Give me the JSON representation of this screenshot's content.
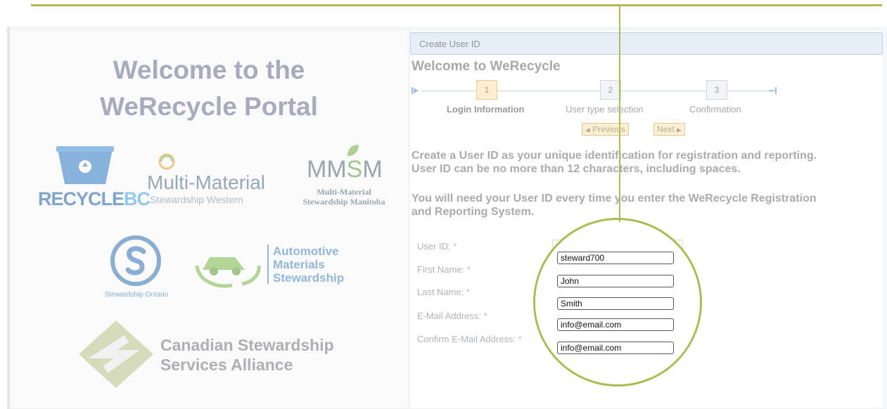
{
  "left_panel": {
    "welcome_line1": "Welcome to the",
    "welcome_line2": "WeRecycle Portal",
    "logos": {
      "recyclebc_a": "RECYCLE",
      "recyclebc_b": "BC",
      "mmsw_main": "Multi-Material",
      "mmsw_sub": "Stewardship Western",
      "mmsm_main_a": "MM",
      "mmsm_main_b": "S",
      "mmsm_main_c": "M",
      "mmsm_sub1": "Multi-Material",
      "mmsm_sub2": "Stewardship Manitoba",
      "so_caption": "Stewardship Ontario",
      "ams1": "Automotive",
      "ams2": "Materials",
      "ams3": "Stewardship",
      "cssa1": "Canadian Stewardship",
      "cssa2": "Services Alliance"
    }
  },
  "panel": {
    "title": "Create User ID",
    "heading": "Welcome to WeRecycle"
  },
  "wizard": {
    "steps": [
      {
        "number": "1",
        "label": "Login Information",
        "active": true
      },
      {
        "number": "2",
        "label": "User type selection",
        "active": false
      },
      {
        "number": "3",
        "label": "Confirmation",
        "active": false
      }
    ],
    "previous_label": "Previous",
    "next_label": "Next"
  },
  "instructions": {
    "line1": "Create a User ID as your unique identification for registration and reporting.",
    "line2": "User ID can be no more than 12 characters, including spaces.",
    "line3": "You will need your User ID every time you enter the WeRecycle Registration",
    "line4": "and Reporting System."
  },
  "form": {
    "required_marker": "*",
    "fields": [
      {
        "label": "User ID:",
        "value": "steward700"
      },
      {
        "label": "First Name:",
        "value": "John"
      },
      {
        "label": "Last Name:",
        "value": "Smith"
      },
      {
        "label": "E-Mail Address:",
        "value": "info@email.com"
      },
      {
        "label": "Confirm E-Mail Address:",
        "value": "info@email.com"
      }
    ]
  },
  "colors": {
    "accent": "#a9bd52",
    "titlebar": "#e6eef7",
    "active_step": "#fcefcf",
    "required": "#ecaaaa"
  }
}
